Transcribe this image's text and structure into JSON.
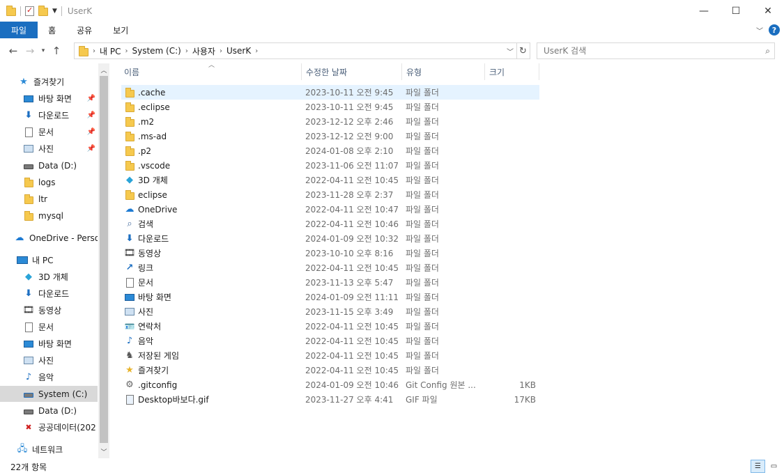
{
  "window": {
    "title": "UserK"
  },
  "ribbon": {
    "tabs": [
      "파일",
      "홈",
      "공유",
      "보기"
    ]
  },
  "address": {
    "crumbs": [
      "내 PC",
      "System (C:)",
      "사용자",
      "UserK"
    ],
    "search_placeholder": "UserK 검색"
  },
  "nav": {
    "items": [
      {
        "label": "즐겨찾기",
        "icon": "star-icon",
        "pinned": false
      },
      {
        "label": "바탕 화면",
        "icon": "desktop-icon",
        "pinned": true
      },
      {
        "label": "다운로드",
        "icon": "download-icon",
        "pinned": true
      },
      {
        "label": "문서",
        "icon": "document-icon",
        "pinned": true
      },
      {
        "label": "사진",
        "icon": "pictures-icon",
        "pinned": true
      },
      {
        "label": "Data (D:)",
        "icon": "drive-icon",
        "pinned": false
      },
      {
        "label": "logs",
        "icon": "folder-icon",
        "pinned": false
      },
      {
        "label": "ltr",
        "icon": "folder-icon",
        "pinned": false
      },
      {
        "label": "mysql",
        "icon": "folder-icon",
        "pinned": false
      },
      {
        "label": "OneDrive - Person",
        "icon": "onedrive-icon",
        "pinned": false
      },
      {
        "label": "내 PC",
        "icon": "pc-icon",
        "pinned": false
      },
      {
        "label": "3D 개체",
        "icon": "3d-objects-icon",
        "pinned": false
      },
      {
        "label": "다운로드",
        "icon": "download-icon",
        "pinned": false
      },
      {
        "label": "동영상",
        "icon": "video-icon",
        "pinned": false
      },
      {
        "label": "문서",
        "icon": "document-icon",
        "pinned": false
      },
      {
        "label": "바탕 화면",
        "icon": "desktop-icon",
        "pinned": false
      },
      {
        "label": "사진",
        "icon": "pictures-icon",
        "pinned": false
      },
      {
        "label": "음악",
        "icon": "music-icon",
        "pinned": false
      },
      {
        "label": "System (C:)",
        "icon": "system-drive-icon",
        "pinned": false,
        "selected": true
      },
      {
        "label": "Data (D:)",
        "icon": "drive-icon",
        "pinned": false
      },
      {
        "label": "공공데이터(202",
        "icon": "network-drive-icon",
        "pinned": false
      },
      {
        "label": "네트워크",
        "icon": "network-icon",
        "pinned": false
      }
    ]
  },
  "columns": {
    "name": "이름",
    "date": "수정한 날짜",
    "type": "유형",
    "size": "크기"
  },
  "files": [
    {
      "name": ".cache",
      "date": "2023-10-11 오전 9:45",
      "type": "파일 폴더",
      "size": "",
      "icon": "folder-icon"
    },
    {
      "name": ".eclipse",
      "date": "2023-10-11 오전 9:45",
      "type": "파일 폴더",
      "size": "",
      "icon": "folder-icon"
    },
    {
      "name": ".m2",
      "date": "2023-12-12 오후 2:46",
      "type": "파일 폴더",
      "size": "",
      "icon": "folder-icon"
    },
    {
      "name": ".ms-ad",
      "date": "2023-12-12 오전 9:00",
      "type": "파일 폴더",
      "size": "",
      "icon": "folder-icon"
    },
    {
      "name": ".p2",
      "date": "2024-01-08 오후 2:10",
      "type": "파일 폴더",
      "size": "",
      "icon": "folder-icon"
    },
    {
      "name": ".vscode",
      "date": "2023-11-06 오전 11:07",
      "type": "파일 폴더",
      "size": "",
      "icon": "folder-icon"
    },
    {
      "name": "3D 개체",
      "date": "2022-04-11 오전 10:45",
      "type": "파일 폴더",
      "size": "",
      "icon": "3d-objects-icon"
    },
    {
      "name": "eclipse",
      "date": "2023-11-28 오후 2:37",
      "type": "파일 폴더",
      "size": "",
      "icon": "folder-icon"
    },
    {
      "name": "OneDrive",
      "date": "2022-04-11 오전 10:47",
      "type": "파일 폴더",
      "size": "",
      "icon": "onedrive-icon"
    },
    {
      "name": "검색",
      "date": "2022-04-11 오전 10:46",
      "type": "파일 폴더",
      "size": "",
      "icon": "search-icon"
    },
    {
      "name": "다운로드",
      "date": "2024-01-09 오전 10:32",
      "type": "파일 폴더",
      "size": "",
      "icon": "download-icon"
    },
    {
      "name": "동영상",
      "date": "2023-10-10 오후 8:16",
      "type": "파일 폴더",
      "size": "",
      "icon": "video-icon"
    },
    {
      "name": "링크",
      "date": "2022-04-11 오전 10:45",
      "type": "파일 폴더",
      "size": "",
      "icon": "link-icon"
    },
    {
      "name": "문서",
      "date": "2023-11-13 오후 5:47",
      "type": "파일 폴더",
      "size": "",
      "icon": "document-icon"
    },
    {
      "name": "바탕 화면",
      "date": "2024-01-09 오전 11:11",
      "type": "파일 폴더",
      "size": "",
      "icon": "desktop-icon"
    },
    {
      "name": "사진",
      "date": "2023-11-15 오후 3:49",
      "type": "파일 폴더",
      "size": "",
      "icon": "pictures-icon"
    },
    {
      "name": "연락처",
      "date": "2022-04-11 오전 10:45",
      "type": "파일 폴더",
      "size": "",
      "icon": "contacts-icon"
    },
    {
      "name": "음악",
      "date": "2022-04-11 오전 10:45",
      "type": "파일 폴더",
      "size": "",
      "icon": "music-icon"
    },
    {
      "name": "저장된 게임",
      "date": "2022-04-11 오전 10:45",
      "type": "파일 폴더",
      "size": "",
      "icon": "saved-games-icon"
    },
    {
      "name": "즐겨찾기",
      "date": "2022-04-11 오전 10:45",
      "type": "파일 폴더",
      "size": "",
      "icon": "favorites-icon"
    },
    {
      "name": ".gitconfig",
      "date": "2024-01-09 오전 10:46",
      "type": "Git Config 원본 ...",
      "size": "1KB",
      "icon": "config-file-icon"
    },
    {
      "name": "Desktop바보다.gif",
      "date": "2023-11-27 오후 4:41",
      "type": "GIF 파일",
      "size": "17KB",
      "icon": "gif-file-icon"
    }
  ],
  "status": {
    "count": "22개 항목"
  }
}
